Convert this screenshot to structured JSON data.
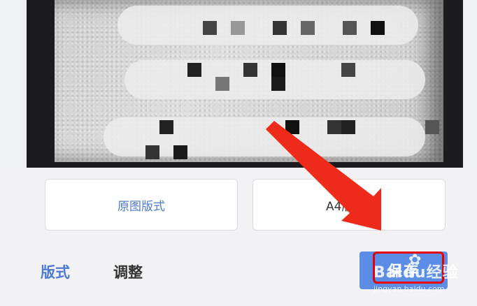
{
  "layout_options": {
    "original": "原图版式",
    "a4": "A4版式"
  },
  "tabs": {
    "format": "版式",
    "adjust": "调整"
  },
  "actions": {
    "save": "保存"
  },
  "watermark": {
    "brand": "Baidu经验",
    "url": "jingyan.baidu.com"
  },
  "colors": {
    "accent": "#4e7ad1",
    "save_button": "#5b8de6",
    "highlight": "#e60000"
  }
}
